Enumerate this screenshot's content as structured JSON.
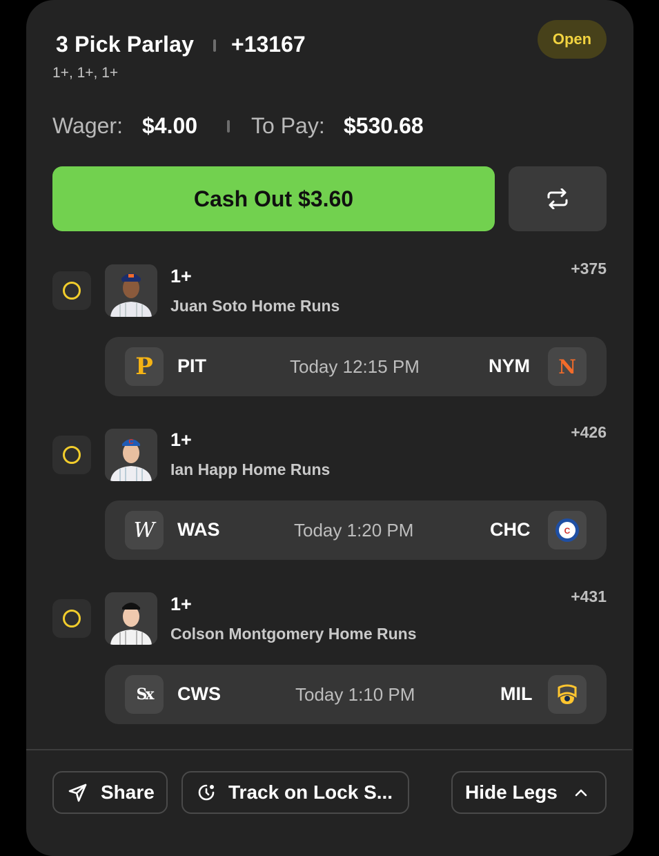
{
  "bet": {
    "title": "3 Pick Parlay",
    "total_odds": "+13167",
    "lines_summary": "1+, 1+, 1+",
    "status": "Open",
    "wager_label": "Wager:",
    "wager_value": "$4.00",
    "payout_label": "To Pay:",
    "payout_value": "$530.68",
    "cashout_label": "Cash Out $3.60"
  },
  "legs": [
    {
      "line": "1+",
      "player_prop": "Juan Soto Home Runs",
      "odds": "+375",
      "game": {
        "away": "PIT",
        "time": "Today 12:15 PM",
        "home": "NYM"
      },
      "cap_color": "#1b2d6b"
    },
    {
      "line": "1+",
      "player_prop": "Ian Happ Home Runs",
      "odds": "+426",
      "game": {
        "away": "WAS",
        "time": "Today 1:20 PM",
        "home": "CHC"
      },
      "cap_color": "#1f5bb5"
    },
    {
      "line": "1+",
      "player_prop": "Colson Montgomery Home Runs",
      "odds": "+431",
      "game": {
        "away": "CWS",
        "time": "Today 1:10 PM",
        "home": "MIL"
      },
      "cap_color": "#111111"
    }
  ],
  "footer": {
    "share_label": "Share",
    "track_label": "Track on Lock S...",
    "hide_legs_label": "Hide Legs"
  },
  "colors": {
    "accent_green": "#72d14f",
    "open_badge_text": "#f2d340",
    "radio_yellow": "#f2cd2c"
  },
  "icons": [
    "swap-icon",
    "radio-pending-icon",
    "share-send-icon",
    "lock-screen-track-icon",
    "chevron-up-icon",
    "team-logo-icon",
    "player-headshot"
  ]
}
